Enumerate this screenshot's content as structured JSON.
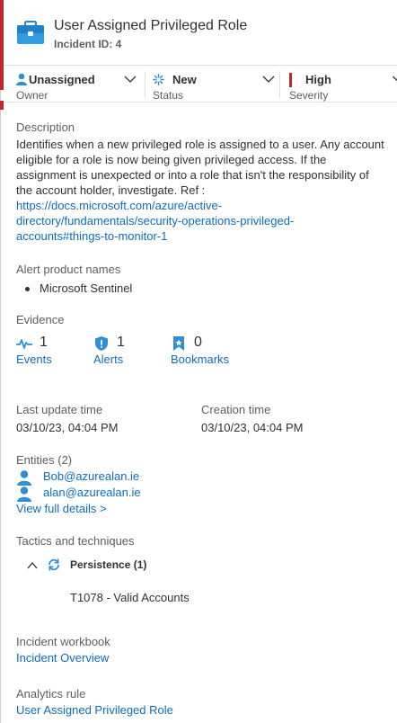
{
  "header": {
    "title": "User Assigned Privileged Role",
    "incident_id": "Incident ID: 4"
  },
  "status_bar": {
    "owner": {
      "value": "Unassigned",
      "label": "Owner"
    },
    "status": {
      "value": "New",
      "label": "Status"
    },
    "severity": {
      "value": "High",
      "label": "Severity",
      "color": "#c4262e"
    }
  },
  "description": {
    "label": "Description",
    "lines": [
      "Identifies when a new privileged role is assigned to a user. Any account",
      "eligible for a role is now being given privileged access. If the",
      "assignment is unexpected or into a role that isn't the responsibility of",
      "the account holder, investigate. Ref :"
    ],
    "link_lines": [
      "https://docs.microsoft.com/azure/active-",
      "directory/fundamentals/security-operations-privileged-",
      "accounts#things-to-monitor-1"
    ]
  },
  "alert_products": {
    "label": "Alert product names",
    "items": [
      "Microsoft Sentinel"
    ]
  },
  "evidence": {
    "label": "Evidence",
    "items": [
      {
        "count": "1",
        "name": "Events",
        "icon": "events-icon"
      },
      {
        "count": "1",
        "name": "Alerts",
        "icon": "shield-icon"
      },
      {
        "count": "0",
        "name": "Bookmarks",
        "icon": "bookmark-icon"
      }
    ]
  },
  "times": {
    "last_update_label": "Last update time",
    "last_update_value": "03/10/23, 04:04 PM",
    "creation_label": "Creation time",
    "creation_value": "03/10/23, 04:04 PM"
  },
  "entities": {
    "label": "Entities (2)",
    "items": [
      "Bob@azurealan.ie",
      "alan@azurealan.ie"
    ],
    "view_details": "View full details >"
  },
  "tactics": {
    "label": "Tactics and techniques",
    "tactic": "Persistence (1)",
    "technique": "T1078 - Valid Accounts"
  },
  "workbook": {
    "label": "Incident workbook",
    "link": "Incident Overview"
  },
  "analytics": {
    "label": "Analytics rule",
    "link": "User Assigned Privileged Role"
  },
  "colors": {
    "accent": "#0f6cbd",
    "severity_high": "#c4262e",
    "icon_blue": "#2f8fd6"
  }
}
